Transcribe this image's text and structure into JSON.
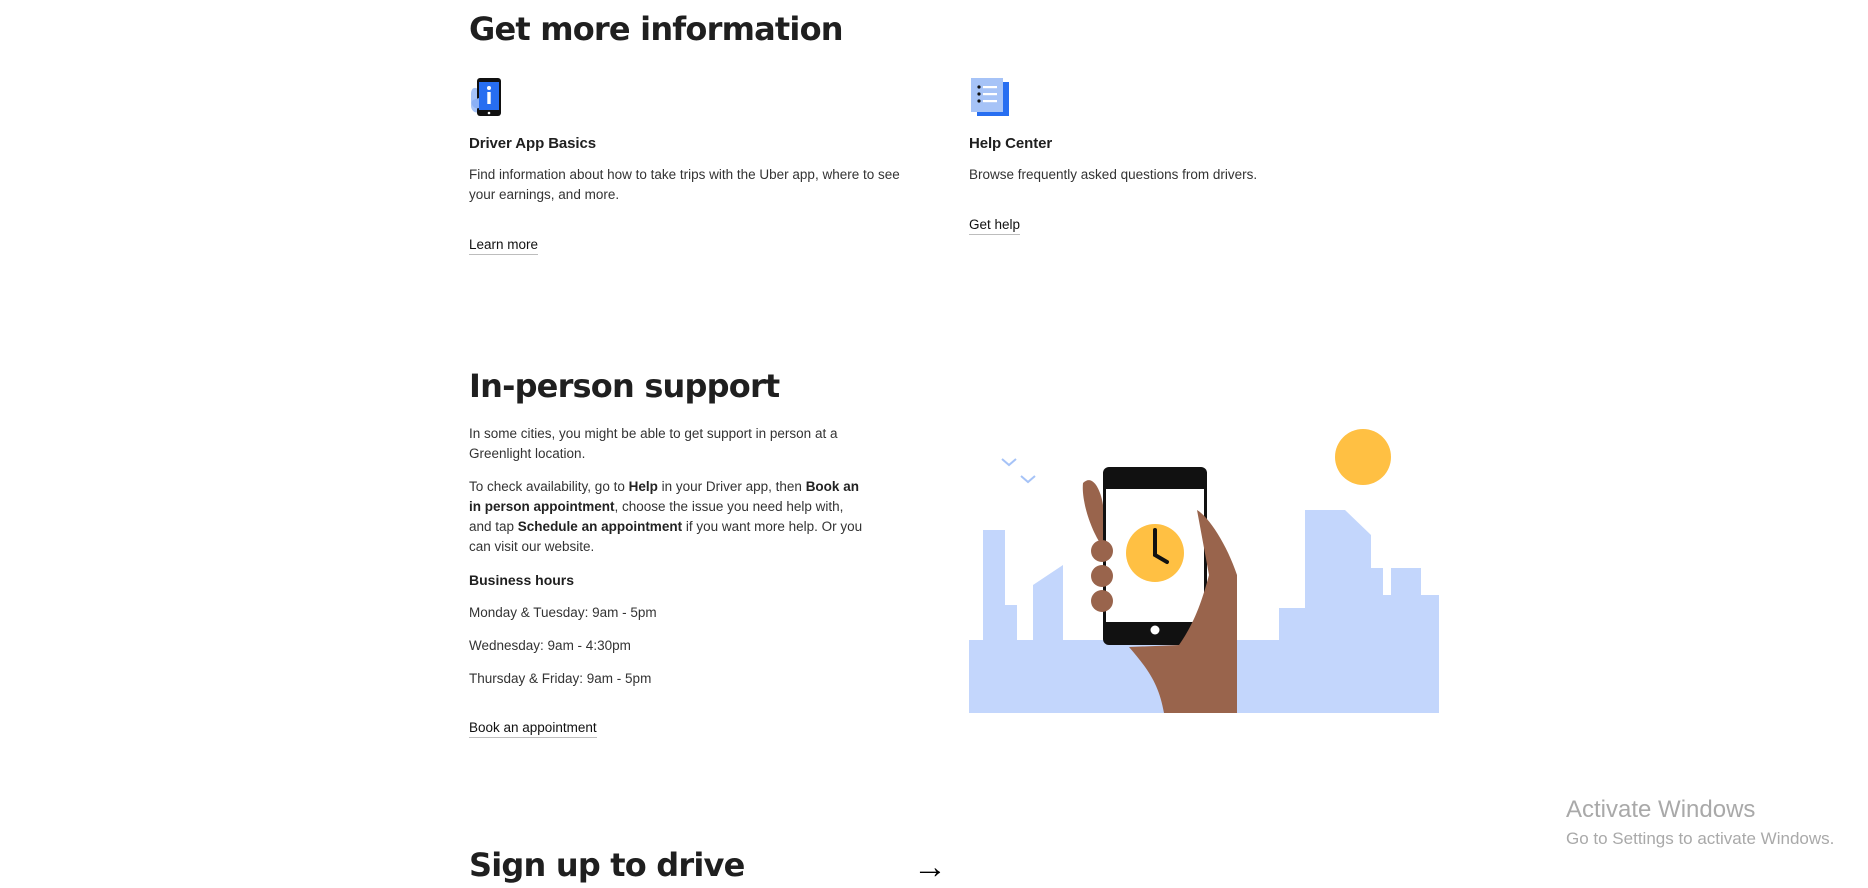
{
  "more_info": {
    "heading": "Get more information",
    "cards": [
      {
        "icon": "phone-info-icon",
        "title": "Driver App Basics",
        "description": "Find information about how to take trips with the Uber app, where to see your earnings, and more.",
        "link": "Learn more"
      },
      {
        "icon": "document-list-icon",
        "title": "Help Center",
        "description": "Browse frequently asked questions from drivers.",
        "link": "Get help"
      }
    ]
  },
  "in_person": {
    "heading": "In-person support",
    "intro": "In some cities, you might be able to get support in person at a Greenlight location.",
    "steps": {
      "t1": "To check availability, go to ",
      "b1": "Help",
      "t2": " in your Driver app, then ",
      "b2": "Book an in person appointment",
      "t3": ", choose the issue you need help with, and tap ",
      "b3": "Schedule an appointment",
      "t4": " if you want more help. Or you can visit our website."
    },
    "hours_label": "Business hours",
    "hours": [
      "Monday & Tuesday: 9am - 5pm",
      "Wednesday: 9am - 4:30pm",
      "Thursday & Friday: 9am - 5pm"
    ],
    "cta": "Book an appointment",
    "illustration": "hand-holding-phone-clock-illustration"
  },
  "signup": {
    "heading": "Sign up to drive",
    "arrow": "→"
  },
  "watermark": {
    "title": "Activate Windows",
    "subtitle": "Go to Settings to activate Windows."
  },
  "colors": {
    "accent_blue": "#276EF1",
    "light_blue": "#C3D6FC",
    "yellow": "#FFC043",
    "skin": "#99644C"
  }
}
